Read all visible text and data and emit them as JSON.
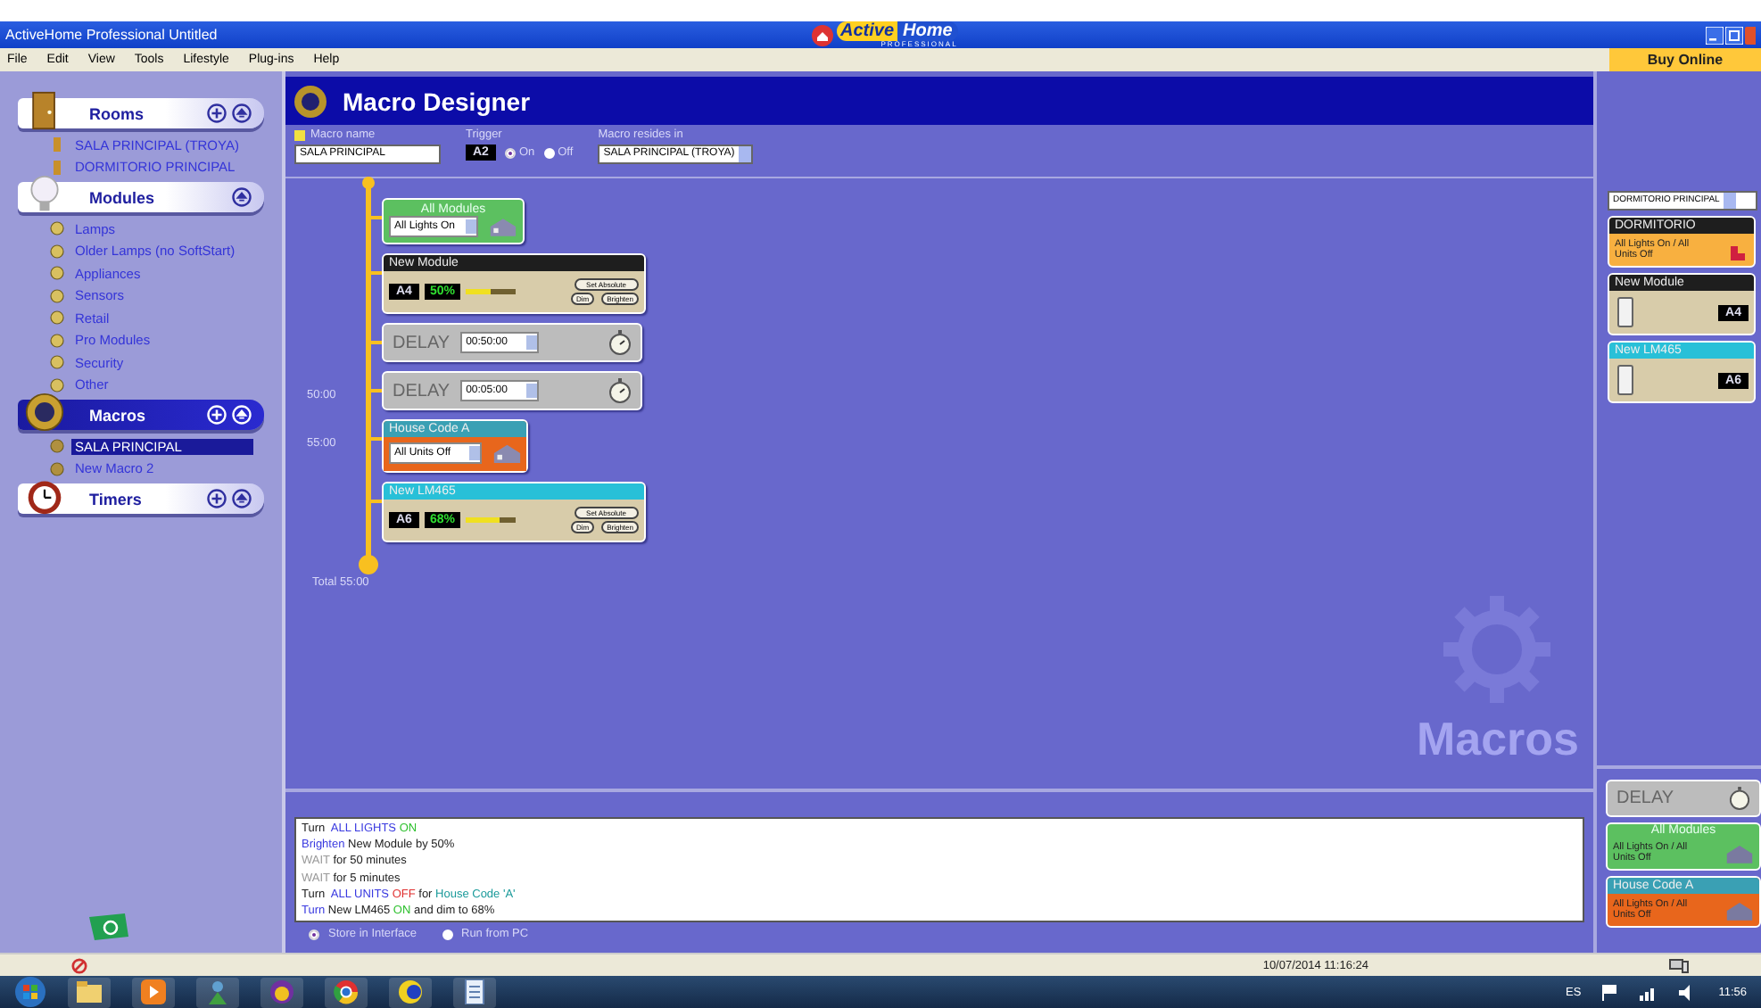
{
  "window": {
    "title": "ActiveHome Professional Untitled",
    "logo_main": "Active",
    "logo_box": "Home",
    "logo_sub": "PROFESSIONAL",
    "buy_button": "Buy Online"
  },
  "menu": [
    "File",
    "Edit",
    "View",
    "Tools",
    "Lifestyle",
    "Plug-ins",
    "Help"
  ],
  "sidebar": {
    "sections": [
      {
        "title": "Rooms",
        "kind": "room",
        "selected": false,
        "add_button": true,
        "items": [
          {
            "label": "SALA PRINCIPAL (TROYA)",
            "selected": false
          },
          {
            "label": "DORMITORIO PRINCIPAL",
            "selected": false
          }
        ]
      },
      {
        "title": "Modules",
        "kind": "module",
        "selected": false,
        "add_button": false,
        "items": [
          {
            "label": "Lamps",
            "selected": false
          },
          {
            "label": "Older Lamps (no SoftStart)",
            "selected": false
          },
          {
            "label": "Appliances",
            "selected": false
          },
          {
            "label": "Sensors",
            "selected": false
          },
          {
            "label": "Retail",
            "selected": false
          },
          {
            "label": "Pro Modules",
            "selected": false
          },
          {
            "label": "Security",
            "selected": false
          },
          {
            "label": "Other",
            "selected": false
          }
        ]
      },
      {
        "title": "Macros",
        "kind": "macro",
        "selected": true,
        "add_button": true,
        "items": [
          {
            "label": "SALA PRINCIPAL",
            "selected": true
          },
          {
            "label": "New Macro 2",
            "selected": false
          }
        ]
      },
      {
        "title": "Timers",
        "kind": "timer",
        "selected": false,
        "add_button": true
      }
    ]
  },
  "designer": {
    "title": "Macro Designer",
    "macro_name_label": "Macro name",
    "macro_name": "SALA PRINCIPAL",
    "trigger_label": "Trigger",
    "trigger_code": "A2",
    "trigger_states": [
      {
        "label": "On",
        "selected": true
      },
      {
        "label": "Off",
        "selected": false
      }
    ],
    "resides_label": "Macro resides in",
    "resides_value": "SALA PRINCIPAL (TROYA)",
    "steps": [
      {
        "kind": "group",
        "title": "All Modules",
        "command": "All Lights On"
      },
      {
        "kind": "module",
        "title": "New Module",
        "color": "#1e1e1e",
        "code": "A4",
        "reading": "50%",
        "level": 0.5,
        "buttons": [
          "Set Absolute",
          "Dim",
          "Brighten"
        ]
      },
      {
        "kind": "delay",
        "label": "DELAY",
        "time": "00:50:00"
      },
      {
        "kind": "delay",
        "label": "DELAY",
        "time": "00:05:00",
        "marker": "50:00"
      },
      {
        "kind": "house",
        "title": "House Code A",
        "color": "#3aa0b4",
        "command": "All Units Off",
        "marker": "55:00"
      },
      {
        "kind": "module",
        "title": "New LM465",
        "color": "#28c0d8",
        "code": "A6",
        "reading": "68%",
        "level": 0.68,
        "buttons": [
          "Set Absolute",
          "Dim",
          "Brighten"
        ]
      }
    ],
    "total": "Total 55:00",
    "watermark": "Macros",
    "log": [
      [
        {
          "text": "Turn  ",
          "kind": "plain"
        },
        {
          "text": "ALL LIGHTS ",
          "kind": "action"
        },
        {
          "text": "ON",
          "kind": "on"
        }
      ],
      [
        {
          "text": "Brighten",
          "kind": "action"
        },
        {
          "text": " New Module by 50%",
          "kind": "plain"
        }
      ],
      [
        {
          "text": "WAIT",
          "kind": "wait"
        },
        {
          "text": " for 50 minutes",
          "kind": "plain"
        }
      ],
      [
        {
          "text": "WAIT",
          "kind": "wait"
        },
        {
          "text": " for 5 minutes",
          "kind": "plain"
        }
      ],
      [
        {
          "text": "Turn  ",
          "kind": "plain"
        },
        {
          "text": "ALL UNITS ",
          "kind": "action"
        },
        {
          "text": "OFF",
          "kind": "off"
        },
        {
          "text": " for ",
          "kind": "plain"
        },
        {
          "text": "House Code 'A'",
          "kind": "house"
        }
      ],
      [
        {
          "text": "Turn",
          "kind": "action"
        },
        {
          "text": " New LM465 ",
          "kind": "plain"
        },
        {
          "text": "ON",
          "kind": "on"
        },
        {
          "text": " and dim to 68%",
          "kind": "plain"
        }
      ]
    ],
    "run_modes": [
      {
        "label": "Store in Interface",
        "selected": true
      },
      {
        "label": "Run from PC",
        "selected": false
      }
    ]
  },
  "palette": {
    "room_select": "DORMITORIO PRINCIPAL",
    "top": [
      {
        "kind": "scene",
        "title": "DORMITORIO",
        "color": "#1e1e1e",
        "text": "All Lights On / All Units Off"
      },
      {
        "kind": "device",
        "title": "New Module",
        "color": "#1e1e1e",
        "code": "A4"
      },
      {
        "kind": "device",
        "title": "New LM465",
        "color": "#28c0d8",
        "code": "A6"
      }
    ],
    "bottom": [
      {
        "kind": "delay",
        "title": "DELAY"
      },
      {
        "kind": "group",
        "title": "All Modules",
        "text": "All Lights On / All Units Off"
      },
      {
        "kind": "house",
        "title": "House Code A",
        "color": "#3aa0b4",
        "text": "All Lights On / All Units Off"
      }
    ]
  },
  "status_bar": {
    "datetime": "10/07/2014 11:16:24"
  },
  "taskbar": {
    "language": "ES",
    "time": "11:56"
  }
}
